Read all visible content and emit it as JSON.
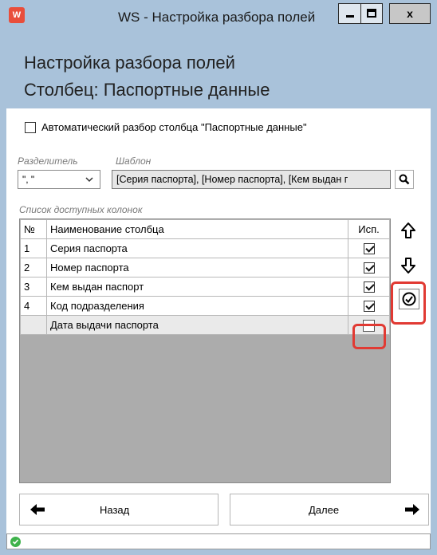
{
  "window": {
    "title": "WS - Настройка разбора полей",
    "minimize_label": "–",
    "close_label": "x"
  },
  "header": {
    "line1": "Настройка разбора полей",
    "line2": "Столбец: Паспортные данные"
  },
  "auto_parse": {
    "label": "Автоматический разбор столбца \"Паспортные данные\"",
    "checked": false
  },
  "separator": {
    "label": "Разделитель",
    "value": "\", \""
  },
  "template": {
    "label": "Шаблон",
    "value": "[Серия паспорта], [Номер паспорта], [Кем выдан г"
  },
  "columns_list": {
    "label": "Список доступных колонок",
    "headers": {
      "num": "№",
      "name": "Наименование столбца",
      "use": "Исп."
    },
    "rows": [
      {
        "num": "1",
        "name": "Серия паспорта",
        "used": true
      },
      {
        "num": "2",
        "name": "Номер паспорта",
        "used": true
      },
      {
        "num": "3",
        "name": "Кем выдан паспорт",
        "used": true
      },
      {
        "num": "4",
        "name": "Код подразделения",
        "used": true
      },
      {
        "num": "",
        "name": "Дата выдачи паспорта",
        "used": false
      }
    ]
  },
  "side_buttons": {
    "up": "arrow-up-icon",
    "down": "arrow-down-icon",
    "ok": "check-circle-icon"
  },
  "nav": {
    "back_label": "Назад",
    "next_label": "Далее"
  },
  "colors": {
    "header_bg": "#a9c2da",
    "highlight": "#e13a33",
    "status_ok": "#3eb24b"
  }
}
